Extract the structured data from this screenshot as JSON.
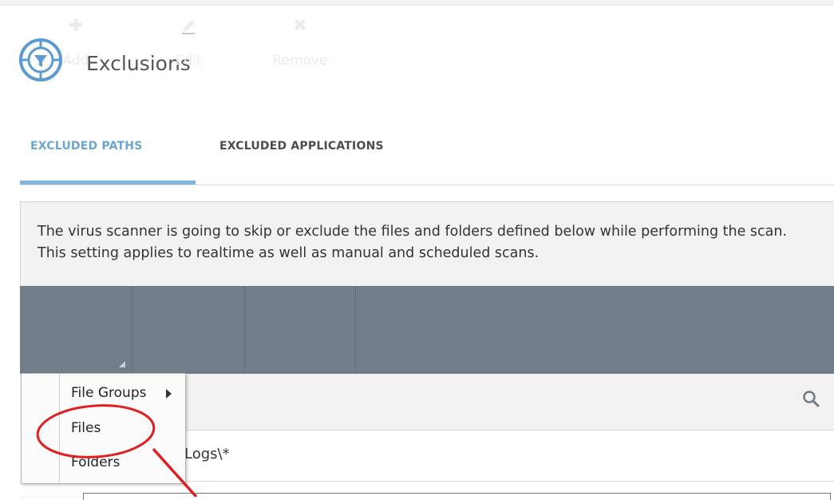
{
  "header": {
    "title": "Exclusions",
    "icon": "exclusion-filter-icon"
  },
  "tabs": [
    {
      "label": "EXCLUDED PATHS",
      "active": true
    },
    {
      "label": "EXCLUDED APPLICATIONS",
      "active": false
    }
  ],
  "description": "The virus scanner is going to skip or exclude the files and folders defined below while performing the scan. This setting applies to realtime as well as manual and scheduled scans.",
  "toolbar": {
    "add_label": "Add",
    "edit_label": "Edit",
    "remove_label": "Remove"
  },
  "add_menu": {
    "items": [
      {
        "label": "File Groups",
        "has_submenu": true
      },
      {
        "label": "Files",
        "has_submenu": false
      },
      {
        "label": "Folders",
        "has_submenu": false
      }
    ]
  },
  "list": {
    "rows": [
      {
        "path_partial": "Logs\\*"
      }
    ]
  },
  "colors": {
    "accent": "#6aa6cf",
    "toolbar_bg": "#737c89",
    "annotation": "#e02020"
  }
}
